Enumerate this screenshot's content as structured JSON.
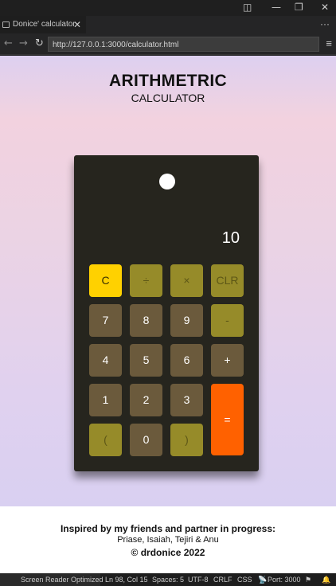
{
  "window": {
    "icons": {
      "layout": "layout-icon",
      "minimize": "minimize-icon",
      "restore": "restore-icon",
      "close": "close-icon"
    },
    "glyphs": {
      "layout": "◫",
      "minimize": "—",
      "restore": "❐",
      "close": "✕"
    }
  },
  "tab": {
    "title": "Donice' calculator",
    "close": "✕",
    "more": "···"
  },
  "address": {
    "back": "←",
    "forward": "→",
    "reload": "↻",
    "url": "http://127.0.0.1:3000/calculator.html",
    "menu": "≡"
  },
  "page": {
    "title": "ARITHMETRIC",
    "subtitle": "CALCULATOR",
    "display_value": "10",
    "keys": {
      "clear": "C",
      "divide": "÷",
      "multiply": "×",
      "clr": "CLR",
      "seven": "7",
      "eight": "8",
      "nine": "9",
      "minus": "-",
      "four": "4",
      "five": "5",
      "six": "6",
      "plus": "+",
      "one": "1",
      "two": "2",
      "three": "3",
      "equals": "=",
      "lparen": "(",
      "zero": "0",
      "rparen": ")"
    },
    "colors": {
      "yellow": "#ffd100",
      "olive": "#968b29",
      "brown": "#6b5a3c",
      "orange": "#ff6100",
      "body": "#26251e"
    },
    "footer": {
      "line1": "Inspired by my friends and partner in progress:",
      "line2": "Priase, Isaiah, Tejiri & Anu",
      "line3": "© drdonice 2022"
    }
  },
  "statusbar": {
    "screen_reader": "Screen Reader Optimized",
    "position": "Ln 98, Col 15",
    "spaces": "Spaces: 5",
    "encoding": "UTF-8",
    "eol": "CRLF",
    "language": "CSS",
    "port": "Port: 3000"
  }
}
